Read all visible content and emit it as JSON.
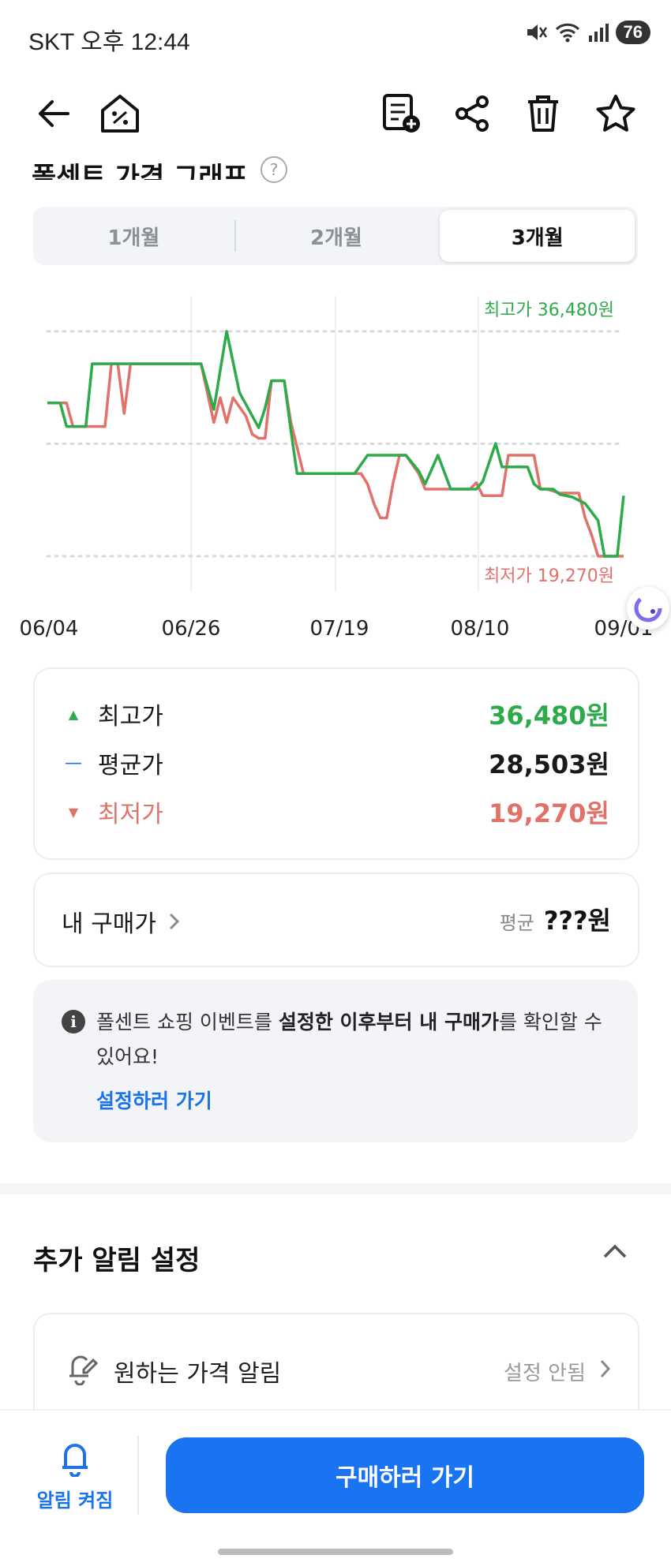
{
  "status": {
    "carrier_time": "SKT 오후 12:44",
    "battery": "76"
  },
  "header": {
    "section_title": "폴센트 가격 그래프",
    "help": "?"
  },
  "tabs": [
    {
      "label": "1개월",
      "active": false
    },
    {
      "label": "2개월",
      "active": false
    },
    {
      "label": "3개월",
      "active": true
    }
  ],
  "chart_data": {
    "type": "line",
    "max_label": "최고가 36,480원",
    "min_label": "최저가 19,270원",
    "x_ticks": [
      "06/04",
      "06/26",
      "07/19",
      "08/10",
      "09/01"
    ],
    "ylim": [
      19270,
      36480
    ],
    "series": [
      {
        "color": "#2daa4a",
        "x": [
          0,
          2,
          3,
          6,
          7,
          9,
          13,
          17,
          19,
          21,
          24,
          26,
          28,
          30,
          33,
          34,
          35,
          36,
          37,
          38,
          39,
          40,
          41,
          42,
          45,
          46,
          48,
          50,
          56,
          58,
          59,
          61,
          63,
          65,
          66,
          67,
          68,
          70,
          71,
          73,
          75,
          76,
          77,
          79,
          80,
          82,
          84,
          86,
          87,
          88,
          89,
          90
        ],
        "y": [
          31000,
          31000,
          29200,
          29200,
          34000,
          34000,
          34000,
          34000,
          34000,
          34000,
          34000,
          30500,
          36480,
          31800,
          29100,
          30600,
          32700,
          32700,
          32700,
          29000,
          25600,
          25600,
          25600,
          25600,
          25600,
          25600,
          25600,
          27000,
          27000,
          25800,
          24800,
          27000,
          24400,
          24400,
          24400,
          24400,
          25000,
          27900,
          26100,
          26100,
          26100,
          24800,
          24400,
          24400,
          24000,
          23800,
          23300,
          22000,
          19270,
          19270,
          19270,
          23900
        ]
      },
      {
        "color": "#e2716a",
        "x": [
          0,
          3,
          4,
          5,
          9,
          10,
          11,
          12,
          13,
          17,
          19,
          21,
          24,
          26,
          27,
          28,
          29,
          31,
          32,
          33,
          34,
          35,
          36,
          37,
          38,
          40,
          42,
          44,
          45,
          46,
          48,
          49,
          50,
          51,
          52,
          53,
          54,
          55,
          56,
          58,
          59,
          60,
          62,
          64,
          65,
          66,
          67,
          68,
          69,
          71,
          72,
          73,
          74,
          76,
          77,
          78,
          80,
          83,
          84,
          85,
          86,
          87,
          88,
          89,
          90
        ],
        "y": [
          31000,
          31000,
          29200,
          29200,
          29200,
          34000,
          34000,
          30200,
          34000,
          34000,
          34000,
          34000,
          34000,
          29500,
          31400,
          29500,
          31400,
          30000,
          28600,
          28300,
          28300,
          32700,
          32700,
          32700,
          29600,
          25600,
          25600,
          25600,
          25600,
          25600,
          25600,
          25600,
          24800,
          23300,
          22200,
          22200,
          24900,
          27000,
          27000,
          25600,
          24400,
          24400,
          24400,
          24400,
          24400,
          24400,
          24900,
          23900,
          23900,
          23900,
          27000,
          27000,
          27000,
          27000,
          24400,
          24400,
          24100,
          24100,
          22200,
          20900,
          19270,
          19270,
          19270,
          19270,
          19270
        ]
      }
    ]
  },
  "summary": {
    "max_label": "최고가",
    "max_value": "36,480원",
    "avg_label": "평균가",
    "avg_value": "28,503원",
    "min_label": "최저가",
    "min_value": "19,270원"
  },
  "purchase": {
    "label": "내 구매가",
    "avg_prefix": "평균",
    "avg_value": "???원"
  },
  "info": {
    "text_1": "폴센트 쇼핑 이벤트를 ",
    "text_bold": "설정한 이후부터 내 구매가",
    "text_2": "를 확인할 수 있어요!",
    "link": "설정하러 가기"
  },
  "alarm_section": {
    "title": "추가 알림 설정",
    "item_label": "원하는 가격 알림",
    "item_status": "설정 안됨"
  },
  "bottom": {
    "alarm_label": "알림 켜짐",
    "buy_label": "구매하러 가기"
  },
  "colors": {
    "high": "#2daa4a",
    "low": "#e2716a",
    "accent": "#1a73f0",
    "avg": "#1a73e8"
  }
}
